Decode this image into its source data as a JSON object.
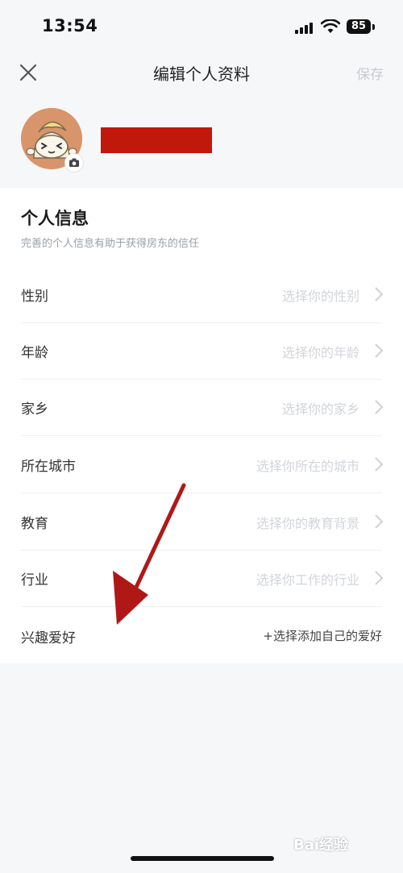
{
  "status_bar": {
    "time": "13:54",
    "battery": "85"
  },
  "nav": {
    "title": "编辑个人资料",
    "save_label": "保存"
  },
  "section": {
    "title": "个人信息",
    "subtitle": "完善的个人信息有助于获得房东的信任"
  },
  "rows": [
    {
      "label": "性别",
      "value": "选择你的性别"
    },
    {
      "label": "年龄",
      "value": "选择你的年龄"
    },
    {
      "label": "家乡",
      "value": "选择你的家乡"
    },
    {
      "label": "所在城市",
      "value": "选择你所在的城市"
    },
    {
      "label": "教育",
      "value": "选择你的教育背景"
    },
    {
      "label": "行业",
      "value": "选择你工作的行业"
    },
    {
      "label": "兴趣爱好",
      "value": "+选择添加自己的爱好"
    }
  ],
  "colors": {
    "annotation_arrow": "#b01818",
    "redaction": "#c0190c",
    "placeholder": "#d2d5da"
  },
  "watermark": "Bai经验"
}
